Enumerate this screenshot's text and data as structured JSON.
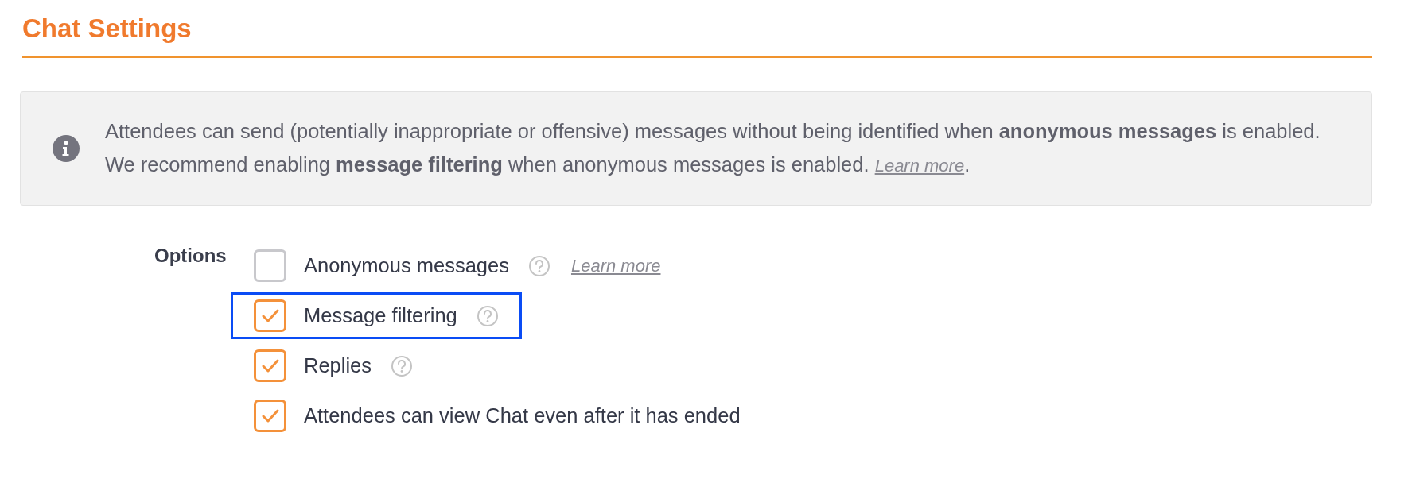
{
  "title": "Chat Settings",
  "notice": {
    "text": "Attendees can send (potentially inappropriate or offensive) messages without being identified when **anonymous messages** is enabled. We recommend enabling **message filtering** when anonymous messages is enabled.",
    "link": "Learn more",
    "after_link": "."
  },
  "options_label": "Options",
  "options": [
    {
      "label": "Anonymous messages",
      "checked": false,
      "help": true,
      "link": "Learn more",
      "highlighted": false
    },
    {
      "label": "Message filtering",
      "checked": true,
      "help": true,
      "highlighted": true
    },
    {
      "label": "Replies",
      "checked": true,
      "help": true,
      "highlighted": false
    },
    {
      "label": "Attendees can view Chat even after it has ended",
      "checked": true,
      "help": false,
      "highlighted": false
    }
  ]
}
